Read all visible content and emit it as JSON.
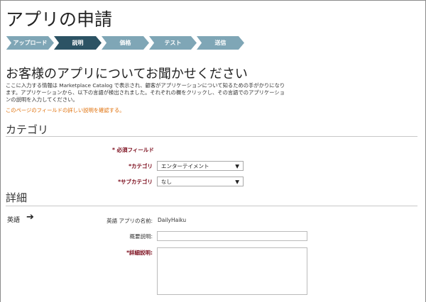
{
  "title": "アプリの申請",
  "steps": [
    {
      "label": "アップロード"
    },
    {
      "label": "説明",
      "active": true
    },
    {
      "label": "価格"
    },
    {
      "label": "テスト"
    },
    {
      "label": "送信"
    }
  ],
  "heading": "お客様のアプリについてお聞かせください",
  "intro": "ここに入力する情報は Marketplace Catalog で表示され、顧客がアプリケーションについて知るための手がかりになります。アプリケーションから、以下の言語が検出されました。それぞれの欄をクリックし、その言語でのアプリケーションの説明を入力してください。",
  "help_link": "このページのフィールドの詳しい説明を確認する。",
  "category_section": {
    "title": "カテゴリ",
    "required_note": "* 必須フィールド",
    "category_label": "*カテゴリ",
    "category_value": "エンターテイメント",
    "subcategory_label": "*サブカテゴリ",
    "subcategory_value": "なし"
  },
  "details_section": {
    "title": "詳細",
    "language": "英語",
    "app_name_label": "英語 アプリの名前:",
    "app_name_value": "DailyHaiku",
    "short_desc_label": "概要説明:",
    "short_desc_value": "",
    "long_desc_label": "*詳細説明:",
    "long_desc_value": ""
  },
  "colors": {
    "step": "#7fa6b6",
    "step_active": "#2c5364",
    "link": "#e0700a",
    "required": "#7a0a1a"
  }
}
